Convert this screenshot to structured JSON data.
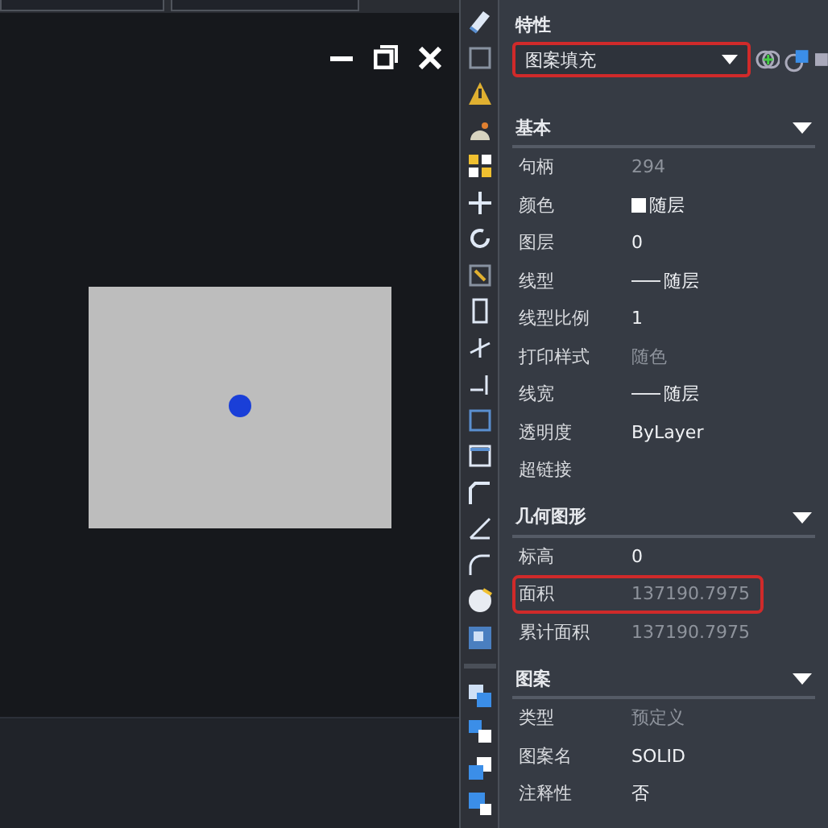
{
  "panel": {
    "title": "特性",
    "object_type": {
      "value": "图案填充",
      "highlighted": true
    },
    "sections": [
      {
        "title": "基本",
        "expanded": true,
        "rows": [
          {
            "label": "句柄",
            "value": "294",
            "kind": "text",
            "disabled": true,
            "highlighted": false
          },
          {
            "label": "颜色",
            "value": "随层",
            "kind": "swatch",
            "disabled": false,
            "highlighted": false
          },
          {
            "label": "图层",
            "value": "0",
            "kind": "text",
            "disabled": false,
            "highlighted": false
          },
          {
            "label": "线型",
            "value": "随层",
            "kind": "linetype",
            "disabled": false,
            "highlighted": false
          },
          {
            "label": "线型比例",
            "value": "1",
            "kind": "text",
            "disabled": false,
            "highlighted": false
          },
          {
            "label": "打印样式",
            "value": "随色",
            "kind": "text",
            "disabled": true,
            "highlighted": false
          },
          {
            "label": "线宽",
            "value": "随层",
            "kind": "linetype",
            "disabled": false,
            "highlighted": false
          },
          {
            "label": "透明度",
            "value": "ByLayer",
            "kind": "text",
            "disabled": false,
            "highlighted": false
          },
          {
            "label": "超链接",
            "kind": "text",
            "highlighted": false
          }
        ]
      },
      {
        "title": "几何图形",
        "expanded": true,
        "rows": [
          {
            "label": "标高",
            "value": "0",
            "kind": "text",
            "disabled": false,
            "highlighted": false
          },
          {
            "label": "面积",
            "value": "137190.7975",
            "kind": "text",
            "disabled": true,
            "highlighted": true
          },
          {
            "label": "累计面积",
            "value": "137190.7975",
            "kind": "text",
            "disabled": true,
            "highlighted": false
          }
        ]
      },
      {
        "title": "图案",
        "expanded": true,
        "rows": [
          {
            "label": "类型",
            "value": "预定义",
            "kind": "text",
            "disabled": true,
            "highlighted": false
          },
          {
            "label": "图案名",
            "value": "SOLID",
            "kind": "text",
            "disabled": false,
            "highlighted": false
          },
          {
            "label": "注释性",
            "value": "否",
            "kind": "text",
            "disabled": false,
            "highlighted": false
          }
        ]
      }
    ]
  }
}
